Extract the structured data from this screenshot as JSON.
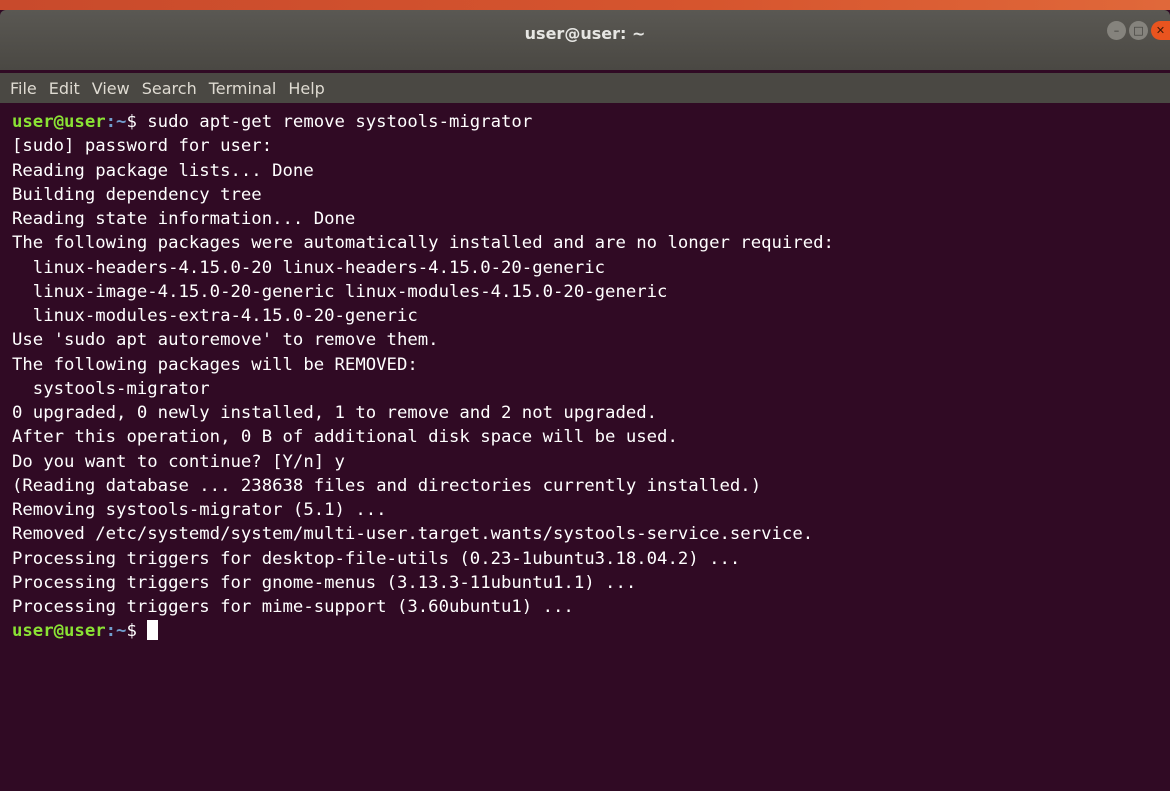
{
  "window": {
    "title": "user@user: ~",
    "buttons": [
      {
        "name": "minimize",
        "glyph": "–"
      },
      {
        "name": "maximize",
        "glyph": "□"
      },
      {
        "name": "close",
        "glyph": "✕"
      }
    ],
    "colors": {
      "background": "#300a24",
      "titlebar": "#4a4843",
      "prompt_user": "#8ae234",
      "prompt_path": "#729fcf",
      "text": "#ffffff"
    }
  },
  "menu": {
    "file": "File",
    "edit": "Edit",
    "view": "View",
    "search": "Search",
    "terminal": "Terminal",
    "help": "Help"
  },
  "terminal": {
    "first_prompt": {
      "user": "user@user",
      "path": ":~",
      "symbol": "$",
      "command": " sudo apt-get remove systools-migrator"
    },
    "output": [
      "[sudo] password for user:",
      "Reading package lists... Done",
      "Building dependency tree",
      "Reading state information... Done",
      "The following packages were automatically installed and are no longer required:",
      "  linux-headers-4.15.0-20 linux-headers-4.15.0-20-generic",
      "  linux-image-4.15.0-20-generic linux-modules-4.15.0-20-generic",
      "  linux-modules-extra-4.15.0-20-generic",
      "Use 'sudo apt autoremove' to remove them.",
      "The following packages will be REMOVED:",
      "  systools-migrator",
      "0 upgraded, 0 newly installed, 1 to remove and 2 not upgraded.",
      "After this operation, 0 B of additional disk space will be used.",
      "Do you want to continue? [Y/n] y",
      "(Reading database ... 238638 files and directories currently installed.)",
      "Removing systools-migrator (5.1) ...",
      "Removed /etc/systemd/system/multi-user.target.wants/systools-service.service.",
      "Processing triggers for desktop-file-utils (0.23-1ubuntu3.18.04.2) ...",
      "Processing triggers for gnome-menus (3.13.3-11ubuntu1.1) ...",
      "Processing triggers for mime-support (3.60ubuntu1) ..."
    ],
    "last_prompt": {
      "user": "user@user",
      "path": ":~",
      "symbol": "$"
    }
  }
}
